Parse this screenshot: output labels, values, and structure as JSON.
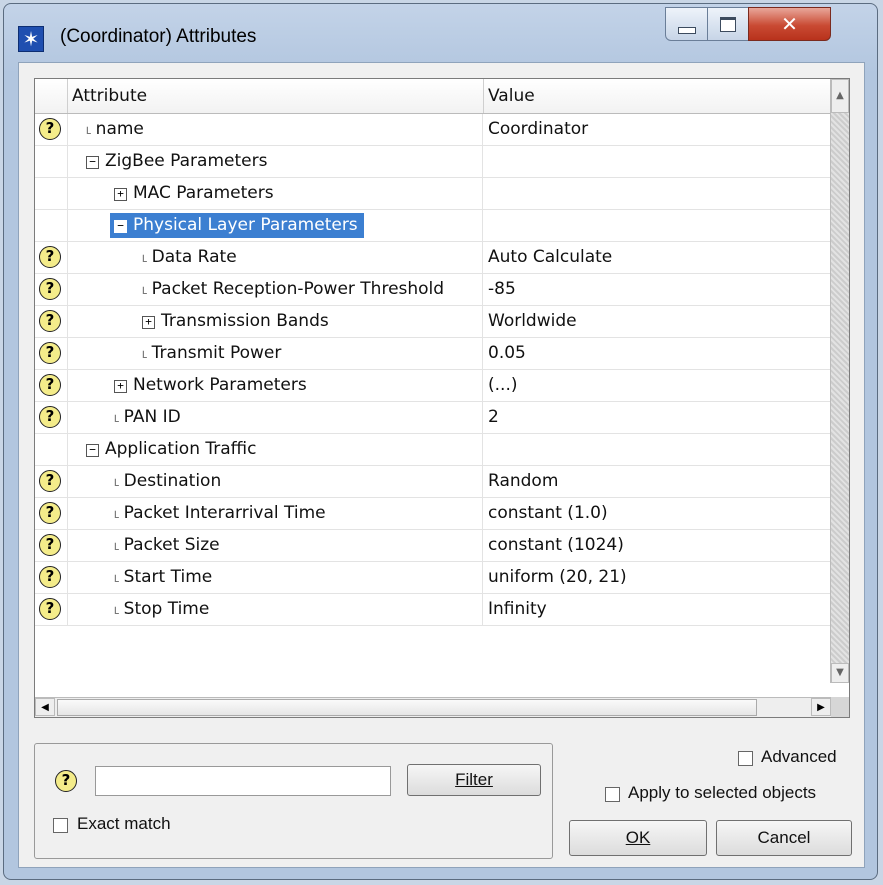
{
  "window": {
    "title": "(Coordinator) Attributes"
  },
  "grid": {
    "columns": {
      "attribute": "Attribute",
      "value": "Value"
    },
    "rows": [
      {
        "help": true,
        "depth": 0,
        "expander": "",
        "label": "name",
        "value": "Coordinator"
      },
      {
        "help": false,
        "depth": 0,
        "expander": "−",
        "label": "ZigBee Parameters",
        "value": ""
      },
      {
        "help": false,
        "depth": 1,
        "expander": "+",
        "label": "MAC Parameters",
        "value": ""
      },
      {
        "help": false,
        "depth": 1,
        "expander": "−",
        "label": "Physical Layer Parameters",
        "value": "",
        "selected": true
      },
      {
        "help": true,
        "depth": 2,
        "expander": "",
        "label": "Data Rate",
        "value": "Auto Calculate"
      },
      {
        "help": true,
        "depth": 2,
        "expander": "",
        "label": "Packet Reception-Power Threshold",
        "value": "-85"
      },
      {
        "help": true,
        "depth": 2,
        "expander": "+",
        "label": "Transmission Bands",
        "value": "Worldwide"
      },
      {
        "help": true,
        "depth": 2,
        "expander": "",
        "label": "Transmit Power",
        "value": "0.05"
      },
      {
        "help": true,
        "depth": 1,
        "expander": "+",
        "label": "Network Parameters",
        "value": "(...)"
      },
      {
        "help": true,
        "depth": 1,
        "expander": "",
        "label": "PAN ID",
        "value": "2"
      },
      {
        "help": false,
        "depth": 0,
        "expander": "−",
        "label": "Application Traffic",
        "value": ""
      },
      {
        "help": true,
        "depth": 1,
        "expander": "",
        "label": "Destination",
        "value": "Random"
      },
      {
        "help": true,
        "depth": 1,
        "expander": "",
        "label": "Packet Interarrival Time",
        "value": "constant (1.0)"
      },
      {
        "help": true,
        "depth": 1,
        "expander": "",
        "label": "Packet Size",
        "value": "constant (1024)"
      },
      {
        "help": true,
        "depth": 1,
        "expander": "",
        "label": "Start Time",
        "value": "uniform (20, 21)"
      },
      {
        "help": true,
        "depth": 1,
        "expander": "",
        "label": "Stop Time",
        "value": "Infinity"
      }
    ]
  },
  "filter": {
    "input_value": "",
    "button_label": "Filter",
    "exact_match_label": "Exact match",
    "exact_match_checked": false
  },
  "options": {
    "advanced_label": "Advanced",
    "advanced_checked": false,
    "apply_selected_label": "Apply to selected objects",
    "apply_selected_checked": false
  },
  "buttons": {
    "ok": "OK",
    "cancel": "Cancel"
  },
  "colors": {
    "selection": "#3c7fd1",
    "help_icon": "#f4ec8a",
    "close_button": "#c94a33"
  }
}
